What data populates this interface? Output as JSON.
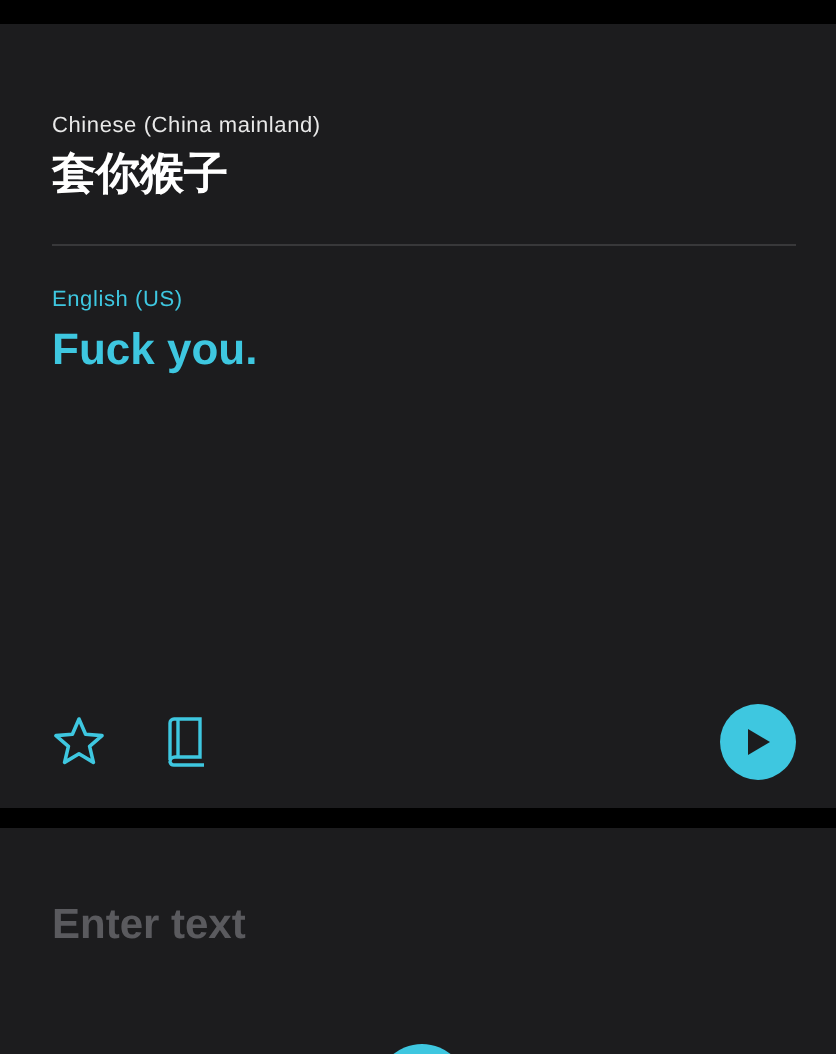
{
  "translation": {
    "source_language": "Chinese (China mainland)",
    "source_text": "套你猴子",
    "target_language": "English (US)",
    "target_text": "Fuck you."
  },
  "input": {
    "placeholder": "Enter text"
  }
}
